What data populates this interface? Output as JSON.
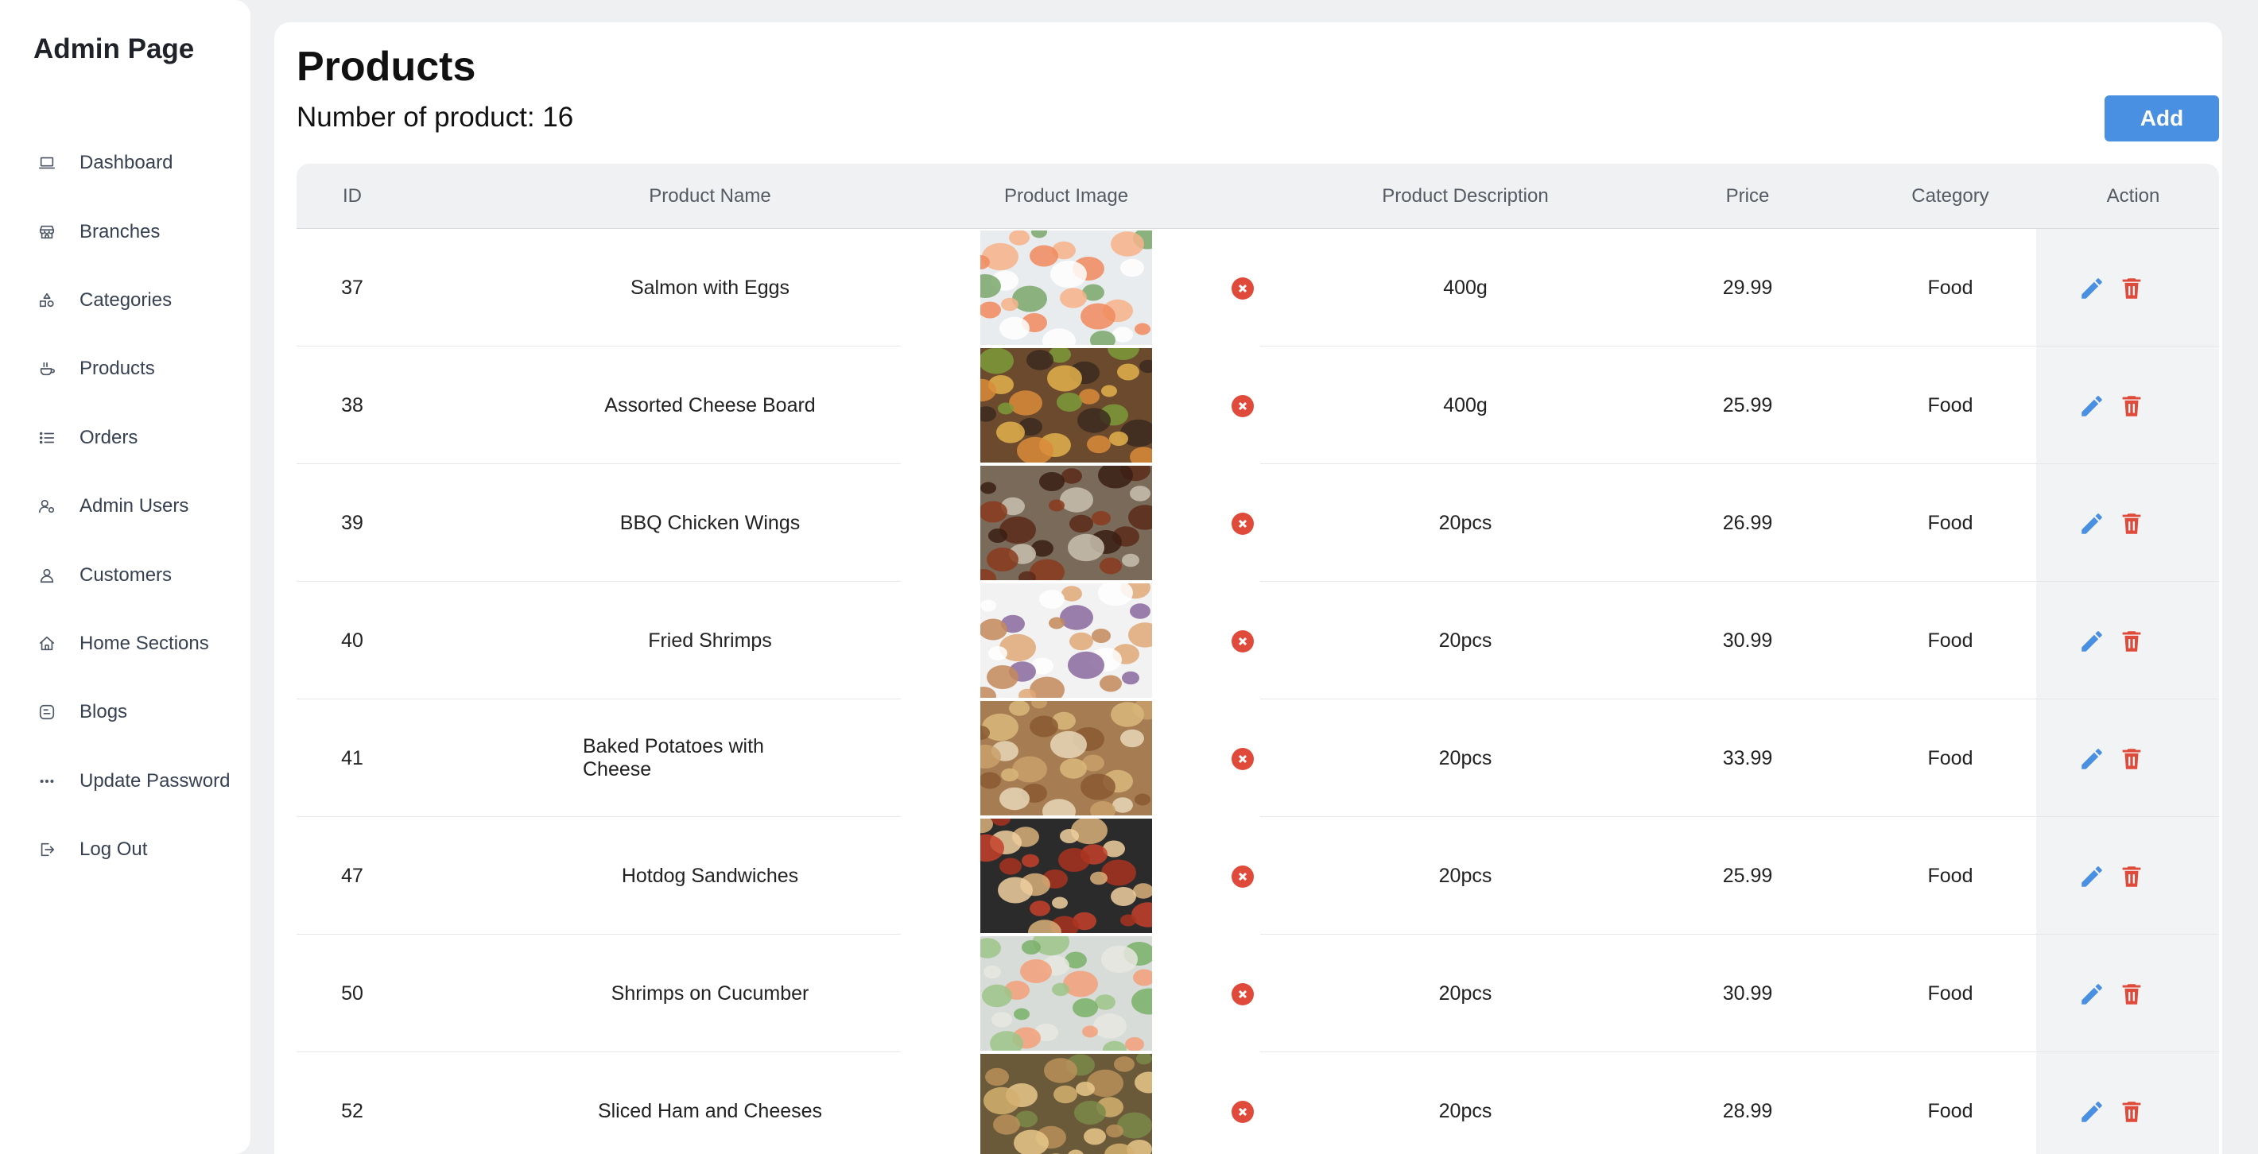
{
  "sidebar": {
    "brand": "Admin Page",
    "items": [
      {
        "label": "Dashboard",
        "icon": "laptop-icon"
      },
      {
        "label": "Branches",
        "icon": "store-icon"
      },
      {
        "label": "Categories",
        "icon": "shapes-icon"
      },
      {
        "label": "Products",
        "icon": "products-icon"
      },
      {
        "label": "Orders",
        "icon": "list-icon"
      },
      {
        "label": "Admin Users",
        "icon": "user-gear-icon"
      },
      {
        "label": "Customers",
        "icon": "user-icon"
      },
      {
        "label": "Home Sections",
        "icon": "home-icon"
      },
      {
        "label": "Blogs",
        "icon": "blog-icon"
      },
      {
        "label": "Update Password",
        "icon": "password-icon"
      },
      {
        "label": "Log Out",
        "icon": "logout-icon"
      }
    ]
  },
  "header": {
    "title": "Products",
    "count_text": "Number of product: 16",
    "add_label": "Add"
  },
  "table": {
    "columns": [
      "ID",
      "Product Name",
      "Product Image",
      "Product Description",
      "Price",
      "Category",
      "Action"
    ],
    "rows": [
      {
        "id": "37",
        "name": "Salmon with Eggs",
        "description": "400g",
        "price": "29.99",
        "category": "Food",
        "image": "salmon-platter-photo"
      },
      {
        "id": "38",
        "name": "Assorted Cheese Board",
        "description": "400g",
        "price": "25.99",
        "category": "Food",
        "image": "cheese-board-photo"
      },
      {
        "id": "39",
        "name": "BBQ Chicken Wings",
        "description": "20pcs",
        "price": "26.99",
        "category": "Food",
        "image": "chicken-wings-photo"
      },
      {
        "id": "40",
        "name": "Fried Shrimps",
        "description": "20pcs",
        "price": "30.99",
        "category": "Food",
        "image": "fried-shrimps-photo"
      },
      {
        "id": "41",
        "name": "Baked Potatoes with Cheese",
        "description": "20pcs",
        "price": "33.99",
        "category": "Food",
        "image": "baked-potatoes-photo"
      },
      {
        "id": "47",
        "name": "Hotdog Sandwiches",
        "description": "20pcs",
        "price": "25.99",
        "category": "Food",
        "image": "hotdogs-photo"
      },
      {
        "id": "50",
        "name": "Shrimps on Cucumber",
        "description": "20pcs",
        "price": "30.99",
        "category": "Food",
        "image": "shrimp-cucumber-photo"
      },
      {
        "id": "52",
        "name": "Sliced Ham and Cheeses",
        "description": "20pcs",
        "price": "28.99",
        "category": "Food",
        "image": "ham-cheese-photo"
      }
    ]
  },
  "colors": {
    "accent": "#4a90e2",
    "danger": "#e04a3a",
    "edit": "#4a90e2"
  }
}
